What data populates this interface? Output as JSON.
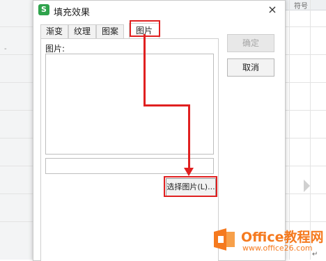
{
  "background": {
    "top_right_text": "符号",
    "return_mark": "↵",
    "left_mark": "-"
  },
  "dialog": {
    "app_icon_letter": "S",
    "title": "填充效果",
    "close_glyph": "×",
    "tabs": [
      {
        "label": "渐变",
        "active": false
      },
      {
        "label": "纹理",
        "active": false
      },
      {
        "label": "图案",
        "active": false
      },
      {
        "label": "图片",
        "active": true
      }
    ],
    "panel_label": "图片:",
    "path_value": "",
    "choose_button_label": "选择图片(L)...",
    "ok_button_label": "确定",
    "ok_disabled": true,
    "cancel_button_label": "取消"
  },
  "watermark": {
    "brand": "Office教程网",
    "url": "www.office26.com"
  },
  "colors": {
    "annotation": "#e02020",
    "app_icon": "#2fa34c",
    "watermark": "#f57a1f"
  }
}
